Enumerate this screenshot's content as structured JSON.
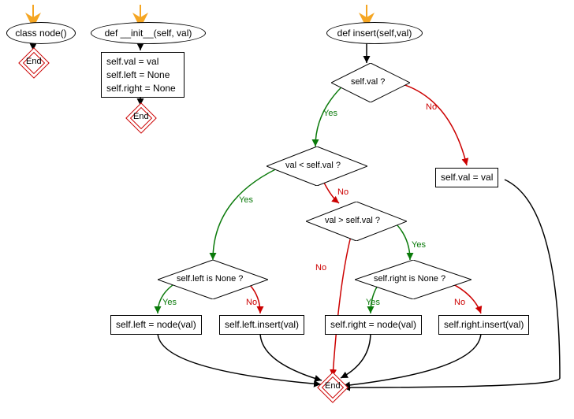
{
  "classNode": {
    "title": "class node()",
    "end": "End"
  },
  "init": {
    "title": "def __init__(self, val)",
    "body": "self.val = val\nself.left = None\nself.right = None",
    "end": "End"
  },
  "insert": {
    "title": "def insert(self,val)",
    "cond1": "self.val ?",
    "else1": "self.val = val",
    "cond2": "val < self.val ?",
    "cond3": "val > self.val ?",
    "cond4l": "self.left is None ?",
    "cond4r": "self.right is None ?",
    "act_ll": "self.left = node(val)",
    "act_lr": "self.left.insert(val)",
    "act_rl": "self.right = node(val)",
    "act_rr": "self.right.insert(val)",
    "end": "End"
  },
  "yes": "Yes",
  "no": "No"
}
